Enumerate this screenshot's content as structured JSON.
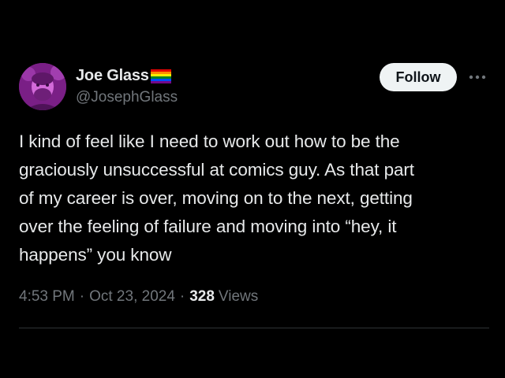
{
  "author": {
    "display_name": "Joe Glass",
    "handle": "@JosephGlass",
    "avatar_icon": "profile-photo-avatar",
    "badge_icon": "rainbow-flag-emoji"
  },
  "actions": {
    "follow_label": "Follow",
    "more_icon": "more-horizontal-icon"
  },
  "tweet": {
    "text": "I kind of feel like I need to work out how to be the\ngraciously unsuccessful at comics guy. As that part\nof my career is over, moving on to the next, getting\nover the feeling of failure and moving into “hey, it\nhappens” you know"
  },
  "meta": {
    "time": "4:53 PM",
    "separator": "·",
    "date": "Oct 23, 2024",
    "views_count": "328",
    "views_label": "Views"
  },
  "colors": {
    "background": "#000000",
    "text_primary": "#e7e9ea",
    "text_secondary": "#71767b",
    "follow_bg": "#eff3f4",
    "follow_text": "#0f1419",
    "divider": "#2f3336"
  }
}
